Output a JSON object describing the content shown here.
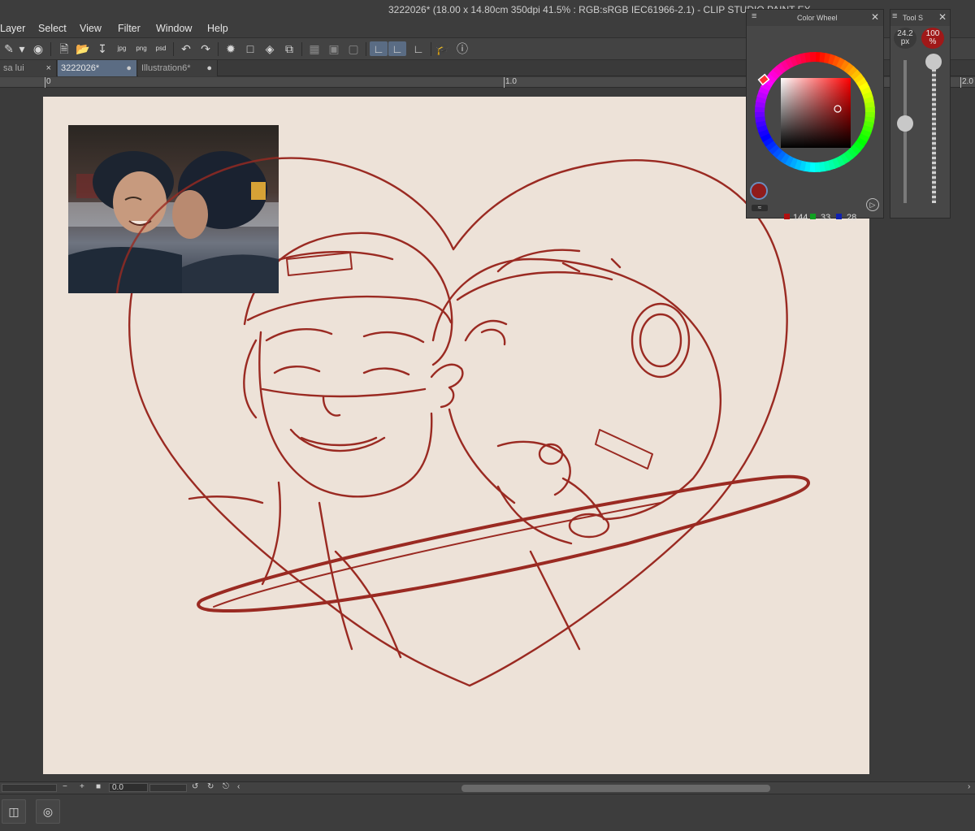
{
  "window": {
    "title": "3222026* (18.00 x 14.80cm 350dpi 41.5% : RGB:sRGB IEC61966-2.1)  - CLIP STUDIO PAINT EX"
  },
  "menu": [
    "Layer",
    "Select",
    "View",
    "Filter",
    "Window",
    "Help"
  ],
  "tabs": [
    {
      "label": "sa lui",
      "state": "×"
    },
    {
      "label": "3222026*",
      "state": "●"
    },
    {
      "label": "Illustration6*",
      "state": "●"
    }
  ],
  "ruler": {
    "labels": [
      "0",
      "1.0",
      "2.0"
    ]
  },
  "color_wheel": {
    "title": "Color Wheel",
    "r": "144",
    "g": "33",
    "b": "28",
    "current_color": "#901c1c"
  },
  "tool_settings": {
    "title": "Tool S",
    "brush_size": "24.2",
    "brush_size_unit": "px",
    "opacity": "100",
    "opacity_unit": "%"
  },
  "status": {
    "rotation": "0.0"
  },
  "colors": {
    "accent": "#5b6c83",
    "ink": "#9a2a22",
    "paper": "#ede2d8"
  }
}
